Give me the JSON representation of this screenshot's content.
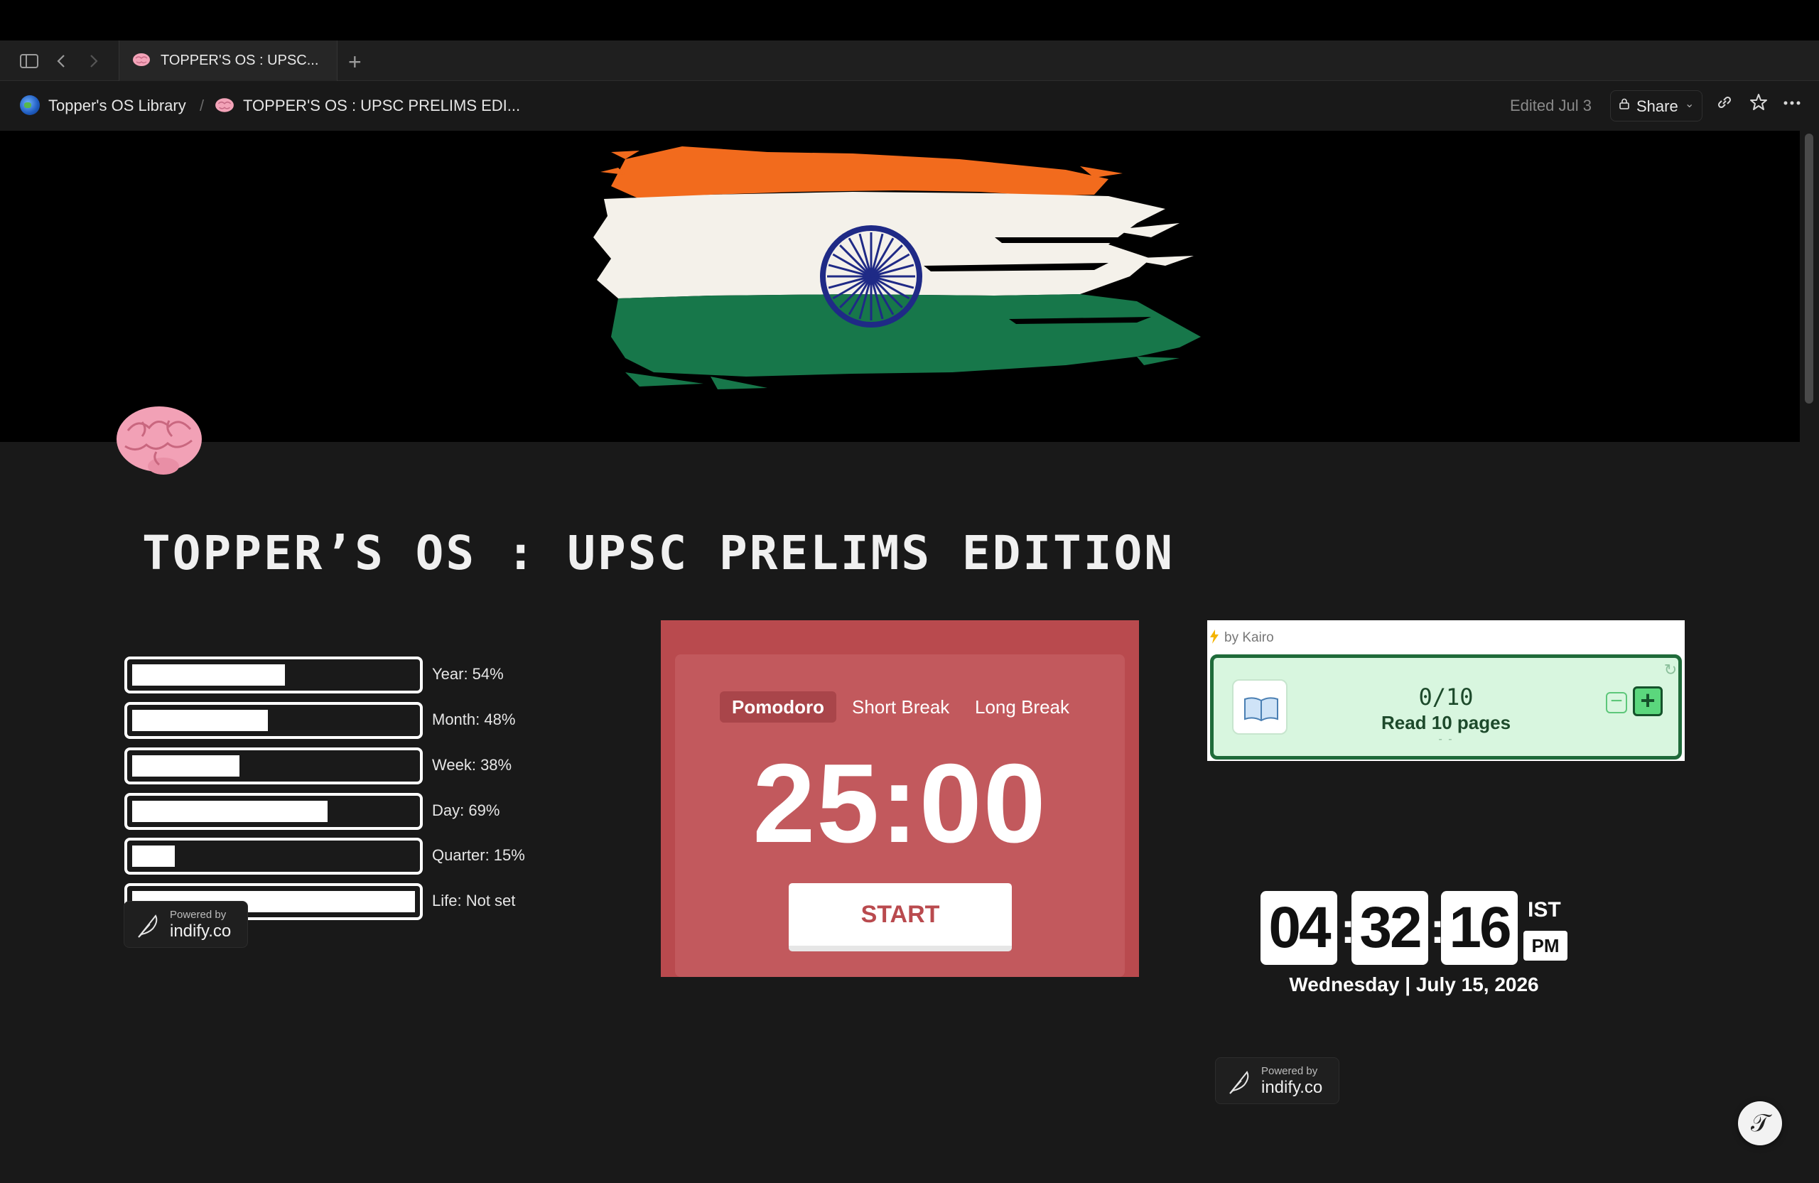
{
  "browser": {
    "tab_title": "TOPPER'S OS : UPSC...",
    "new_tab": "+"
  },
  "breadcrumb": {
    "parent": "Topper's OS Library",
    "current": "TOPPER'S OS : UPSC PRELIMS EDI...",
    "separator": "/"
  },
  "header": {
    "edited": "Edited Jul 3",
    "share_label": "Share"
  },
  "page": {
    "title": "TOPPER’S OS : UPSC PRELIMS EDITION"
  },
  "progress": {
    "items": [
      {
        "label": "Year: 54%",
        "fraction": 0.54
      },
      {
        "label": "Month: 48%",
        "fraction": 0.48
      },
      {
        "label": "Week: 38%",
        "fraction": 0.38
      },
      {
        "label": "Day: 69%",
        "fraction": 0.69
      },
      {
        "label": "Quarter: 15%",
        "fraction": 0.15
      },
      {
        "label": "Life: Not set",
        "fraction": 1.0
      }
    ],
    "powered_by": "Powered by",
    "powered_brand": "indify.co"
  },
  "pomodoro": {
    "tabs": [
      "Pomodoro",
      "Short Break",
      "Long Break"
    ],
    "active_tab": "Pomodoro",
    "time": "25:00",
    "start_label": "START",
    "color": "#b94a4e"
  },
  "habit": {
    "by": "by Kairo",
    "count": "0/10",
    "text": "Read 10 pages",
    "dash": "- -"
  },
  "clock": {
    "hours": "04",
    "minutes": "32",
    "seconds": "16",
    "zone": "IST",
    "ampm": "PM",
    "date": "Wednesday | July 15, 2026",
    "powered_by": "Powered by",
    "powered_brand": "indify.co"
  },
  "icons": [
    "sidebar-toggle-icon",
    "back-icon",
    "forward-icon",
    "brain-icon",
    "globe-icon",
    "lock-icon",
    "link-icon",
    "star-icon",
    "more-icon",
    "feather-icon",
    "book-icon",
    "help-icon"
  ]
}
